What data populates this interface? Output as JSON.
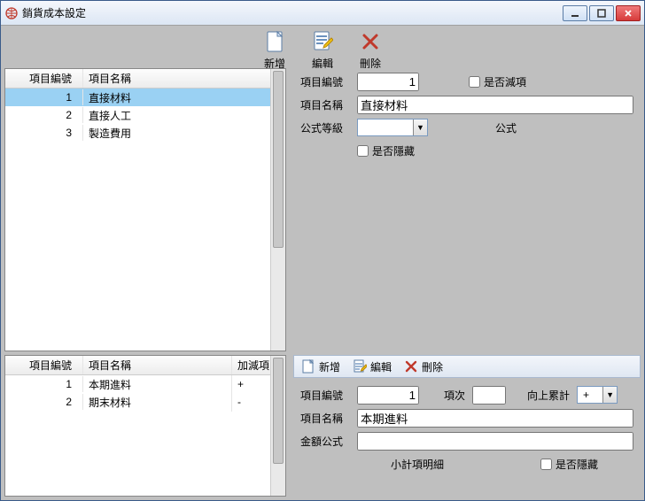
{
  "window": {
    "title": "銷貨成本設定"
  },
  "toolbar": {
    "add": "新增",
    "edit": "編輯",
    "delete": "刪除"
  },
  "upperGrid": {
    "col_no": "項目編號",
    "col_name": "項目名稱",
    "rows": [
      {
        "no": "1",
        "name": "直接材料"
      },
      {
        "no": "2",
        "name": "直接人工"
      },
      {
        "no": "3",
        "name": "製造費用"
      }
    ]
  },
  "upperForm": {
    "item_no_label": "項目編號",
    "item_no_value": "1",
    "is_deduction_label": "是否減項",
    "item_name_label": "項目名稱",
    "item_name_value": "直接材料",
    "formula_level_label": "公式等級",
    "formula_level_value": "",
    "formula_label": "公式",
    "is_hidden_label": "是否隱藏"
  },
  "subtoolbar": {
    "add": "新增",
    "edit": "編輯",
    "delete": "刪除"
  },
  "lowerGrid": {
    "col_no": "項目編號",
    "col_name": "項目名稱",
    "col_pm": "加減項",
    "rows": [
      {
        "no": "1",
        "name": "本期進料",
        "pm": "+"
      },
      {
        "no": "2",
        "name": "期末材料",
        "pm": "-"
      }
    ]
  },
  "lowerForm": {
    "item_no_label": "項目編號",
    "item_no_value": "1",
    "seq_label": "項次",
    "seq_value": "",
    "accum_label": "向上累計",
    "accum_value": "+",
    "item_name_label": "項目名稱",
    "item_name_value": "本期進料",
    "amount_formula_label": "金額公式",
    "amount_formula_value": "",
    "is_hidden_label": "是否隱藏",
    "subtotal_label": "小計項明細"
  }
}
